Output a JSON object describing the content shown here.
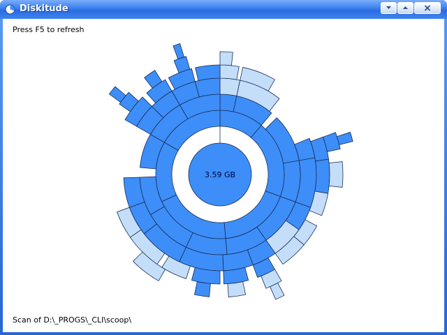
{
  "window": {
    "title": "Diskitude"
  },
  "toolbar": {
    "minimize_icon": "minimize-icon",
    "restore_icon": "restore-icon",
    "close_icon": "close-icon"
  },
  "main": {
    "refresh_hint": "Press F5 to refresh",
    "total_size": "3.59 GB",
    "scan_status": "Scan of D:\\_PROGS\\_CLI\\scoop\\"
  },
  "colors": {
    "directory": "#3d8ef8",
    "file": "#c4defa",
    "outline": "#1a2c58"
  }
}
